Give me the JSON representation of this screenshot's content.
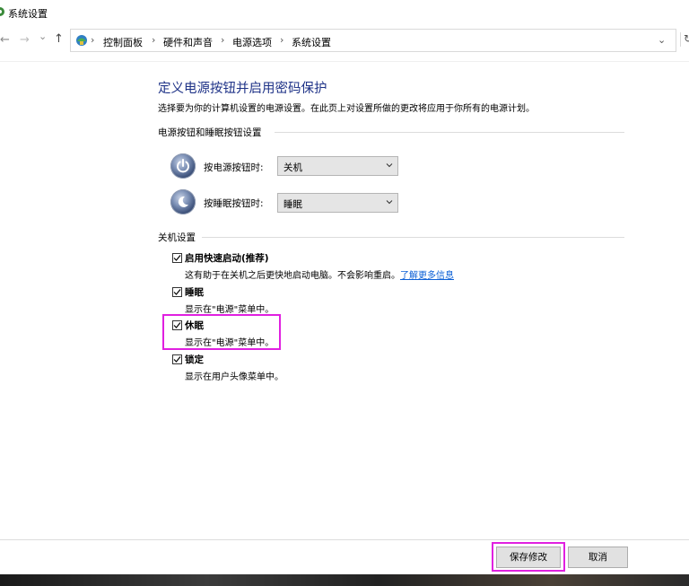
{
  "window": {
    "title": "系统设置"
  },
  "nav": {
    "back_glyph": "←",
    "forward_glyph": "→",
    "recent_glyph": "⌄",
    "up_glyph": "↑",
    "breadcrumbs": [
      "控制面板",
      "硬件和声音",
      "电源选项",
      "系统设置"
    ],
    "separator": "›",
    "dropdown_glyph": "⌄",
    "refresh_glyph": "↻"
  },
  "content": {
    "heading": "定义电源按钮并启用密码保护",
    "description": "选择要为你的计算机设置的电源设置。在此页上对设置所做的更改将应用于你所有的电源计划。",
    "buttons_section": {
      "title": "电源按钮和睡眠按钮设置",
      "power_button": {
        "label": "按电源按钮时:",
        "value": "关机"
      },
      "sleep_button": {
        "label": "按睡眠按钮时:",
        "value": "睡眠"
      }
    },
    "shutdown_section": {
      "title": "关机设置",
      "items": [
        {
          "label": "启用快速启动(推荐)",
          "checked": true,
          "description": "这有助于在关机之后更快地启动电脑。不会影响重启。",
          "link": "了解更多信息"
        },
        {
          "label": "睡眠",
          "checked": true,
          "description": "显示在\"电源\"菜单中。"
        },
        {
          "label": "休眠",
          "checked": true,
          "description": "显示在\"电源\"菜单中。"
        },
        {
          "label": "锁定",
          "checked": true,
          "description": "显示在用户头像菜单中。"
        }
      ]
    }
  },
  "footer": {
    "save_label": "保存修改",
    "cancel_label": "取消"
  },
  "colors": {
    "heading": "#1e3287",
    "link": "#0b5fd6",
    "highlight": "#e020e0"
  }
}
